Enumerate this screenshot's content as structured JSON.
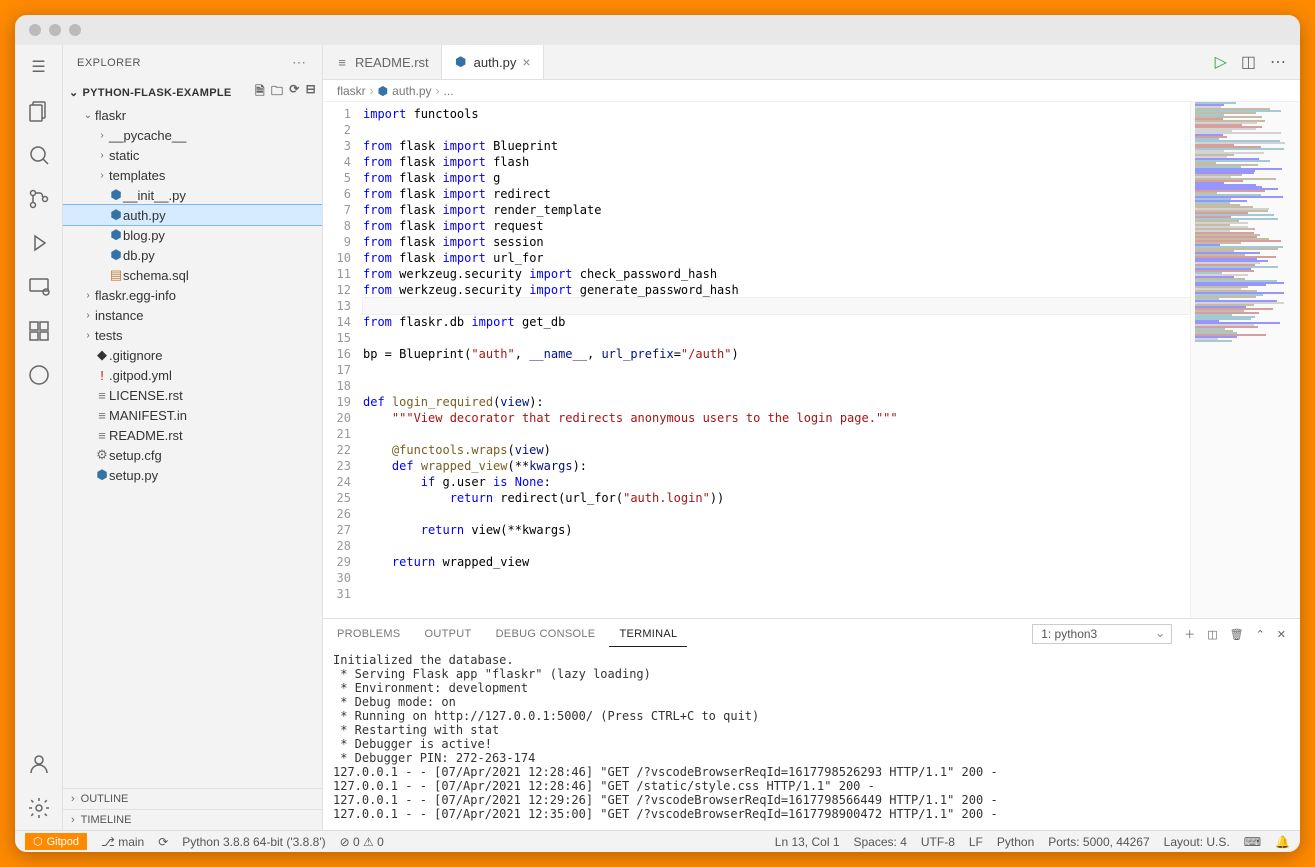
{
  "sidebar": {
    "title": "EXPLORER",
    "project": "PYTHON-FLASK-EXAMPLE",
    "outline": "OUTLINE",
    "timeline": "TIMELINE"
  },
  "tree": [
    {
      "depth": 1,
      "arrow": "⌄",
      "icon": "",
      "label": "flaskr",
      "kind": "folder"
    },
    {
      "depth": 2,
      "arrow": "›",
      "icon": "",
      "label": "__pycache__",
      "kind": "folder"
    },
    {
      "depth": 2,
      "arrow": "›",
      "icon": "",
      "label": "static",
      "kind": "folder"
    },
    {
      "depth": 2,
      "arrow": "›",
      "icon": "",
      "label": "templates",
      "kind": "folder"
    },
    {
      "depth": 2,
      "arrow": "",
      "icon": "py",
      "label": "__init__.py",
      "kind": "file"
    },
    {
      "depth": 2,
      "arrow": "",
      "icon": "py",
      "label": "auth.py",
      "kind": "file",
      "selected": true
    },
    {
      "depth": 2,
      "arrow": "",
      "icon": "py",
      "label": "blog.py",
      "kind": "file"
    },
    {
      "depth": 2,
      "arrow": "",
      "icon": "py",
      "label": "db.py",
      "kind": "file"
    },
    {
      "depth": 2,
      "arrow": "",
      "icon": "sql",
      "label": "schema.sql",
      "kind": "file"
    },
    {
      "depth": 1,
      "arrow": "›",
      "icon": "",
      "label": "flaskr.egg-info",
      "kind": "folder"
    },
    {
      "depth": 1,
      "arrow": "›",
      "icon": "",
      "label": "instance",
      "kind": "folder"
    },
    {
      "depth": 1,
      "arrow": "›",
      "icon": "",
      "label": "tests",
      "kind": "folder"
    },
    {
      "depth": 1,
      "arrow": "",
      "icon": "git",
      "label": ".gitignore",
      "kind": "file"
    },
    {
      "depth": 1,
      "arrow": "",
      "icon": "yml",
      "label": ".gitpod.yml",
      "kind": "file"
    },
    {
      "depth": 1,
      "arrow": "",
      "icon": "rst",
      "label": "LICENSE.rst",
      "kind": "file"
    },
    {
      "depth": 1,
      "arrow": "",
      "icon": "txt",
      "label": "MANIFEST.in",
      "kind": "file"
    },
    {
      "depth": 1,
      "arrow": "",
      "icon": "rst",
      "label": "README.rst",
      "kind": "file"
    },
    {
      "depth": 1,
      "arrow": "",
      "icon": "cfg",
      "label": "setup.cfg",
      "kind": "file"
    },
    {
      "depth": 1,
      "arrow": "",
      "icon": "py",
      "label": "setup.py",
      "kind": "file"
    }
  ],
  "tabs": [
    {
      "icon": "rst",
      "label": "README.rst",
      "active": false
    },
    {
      "icon": "py",
      "label": "auth.py",
      "active": true
    }
  ],
  "breadcrumb": [
    "flaskr",
    "auth.py",
    "..."
  ],
  "code": [
    [
      [
        "kw",
        "import"
      ],
      [
        "op",
        " functools"
      ]
    ],
    [],
    [
      [
        "kw",
        "from"
      ],
      [
        "op",
        " flask "
      ],
      [
        "kw",
        "import"
      ],
      [
        "op",
        " Blueprint"
      ]
    ],
    [
      [
        "kw",
        "from"
      ],
      [
        "op",
        " flask "
      ],
      [
        "kw",
        "import"
      ],
      [
        "op",
        " flash"
      ]
    ],
    [
      [
        "kw",
        "from"
      ],
      [
        "op",
        " flask "
      ],
      [
        "kw",
        "import"
      ],
      [
        "op",
        " g"
      ]
    ],
    [
      [
        "kw",
        "from"
      ],
      [
        "op",
        " flask "
      ],
      [
        "kw",
        "import"
      ],
      [
        "op",
        " redirect"
      ]
    ],
    [
      [
        "kw",
        "from"
      ],
      [
        "op",
        " flask "
      ],
      [
        "kw",
        "import"
      ],
      [
        "op",
        " render_template"
      ]
    ],
    [
      [
        "kw",
        "from"
      ],
      [
        "op",
        " flask "
      ],
      [
        "kw",
        "import"
      ],
      [
        "op",
        " request"
      ]
    ],
    [
      [
        "kw",
        "from"
      ],
      [
        "op",
        " flask "
      ],
      [
        "kw",
        "import"
      ],
      [
        "op",
        " session"
      ]
    ],
    [
      [
        "kw",
        "from"
      ],
      [
        "op",
        " flask "
      ],
      [
        "kw",
        "import"
      ],
      [
        "op",
        " url_for"
      ]
    ],
    [
      [
        "kw",
        "from"
      ],
      [
        "op",
        " werkzeug.security "
      ],
      [
        "kw",
        "import"
      ],
      [
        "op",
        " check_password_hash"
      ]
    ],
    [
      [
        "kw",
        "from"
      ],
      [
        "op",
        " werkzeug.security "
      ],
      [
        "kw",
        "import"
      ],
      [
        "op",
        " generate_password_hash"
      ]
    ],
    [],
    [
      [
        "kw",
        "from"
      ],
      [
        "op",
        " flaskr.db "
      ],
      [
        "kw",
        "import"
      ],
      [
        "op",
        " get_db"
      ]
    ],
    [],
    [
      [
        "op",
        "bp = Blueprint("
      ],
      [
        "st",
        "\"auth\""
      ],
      [
        "op",
        ", "
      ],
      [
        "va",
        "__name__"
      ],
      [
        "op",
        ", "
      ],
      [
        "va",
        "url_prefix"
      ],
      [
        "op",
        "="
      ],
      [
        "st",
        "\"/auth\""
      ],
      [
        "op",
        ")"
      ]
    ],
    [],
    [],
    [
      [
        "kw",
        "def "
      ],
      [
        "fn",
        "login_required"
      ],
      [
        "op",
        "("
      ],
      [
        "va",
        "view"
      ],
      [
        "op",
        "):"
      ]
    ],
    [
      [
        "op",
        "    "
      ],
      [
        "st",
        "\"\"\"View decorator that redirects anonymous users to the login page.\"\"\""
      ]
    ],
    [],
    [
      [
        "op",
        "    "
      ],
      [
        "fn",
        "@functools.wraps"
      ],
      [
        "op",
        "("
      ],
      [
        "va",
        "view"
      ],
      [
        "op",
        ")"
      ]
    ],
    [
      [
        "op",
        "    "
      ],
      [
        "kw",
        "def "
      ],
      [
        "fn",
        "wrapped_view"
      ],
      [
        "op",
        "(**"
      ],
      [
        "va",
        "kwargs"
      ],
      [
        "op",
        "):"
      ]
    ],
    [
      [
        "op",
        "        "
      ],
      [
        "kw",
        "if"
      ],
      [
        "op",
        " g.user "
      ],
      [
        "kw",
        "is"
      ],
      [
        "op",
        " "
      ],
      [
        "kw",
        "None"
      ],
      [
        "op",
        ":"
      ]
    ],
    [
      [
        "op",
        "            "
      ],
      [
        "kw",
        "return"
      ],
      [
        "op",
        " redirect(url_for("
      ],
      [
        "st",
        "\"auth.login\""
      ],
      [
        "op",
        "))"
      ]
    ],
    [],
    [
      [
        "op",
        "        "
      ],
      [
        "kw",
        "return"
      ],
      [
        "op",
        " view(**kwargs)"
      ]
    ],
    [],
    [
      [
        "op",
        "    "
      ],
      [
        "kw",
        "return"
      ],
      [
        "op",
        " wrapped_view"
      ]
    ],
    [],
    []
  ],
  "cursor_line": 13,
  "panel": {
    "tabs": [
      "PROBLEMS",
      "OUTPUT",
      "DEBUG CONSOLE",
      "TERMINAL"
    ],
    "active": 3,
    "select": "1: python3",
    "terminal": "Initialized the database.\n * Serving Flask app \"flaskr\" (lazy loading)\n * Environment: development\n * Debug mode: on\n * Running on http://127.0.0.1:5000/ (Press CTRL+C to quit)\n * Restarting with stat\n * Debugger is active!\n * Debugger PIN: 272-263-174\n127.0.0.1 - - [07/Apr/2021 12:28:46] \"GET /?vscodeBrowserReqId=1617798526293 HTTP/1.1\" 200 -\n127.0.0.1 - - [07/Apr/2021 12:28:46] \"GET /static/style.css HTTP/1.1\" 200 -\n127.0.0.1 - - [07/Apr/2021 12:29:26] \"GET /?vscodeBrowserReqId=1617798566449 HTTP/1.1\" 200 -\n127.0.0.1 - - [07/Apr/2021 12:35:00] \"GET /?vscodeBrowserReqId=1617798900472 HTTP/1.1\" 200 -"
  },
  "statusbar": {
    "gitpod": "Gitpod",
    "branch": "main",
    "python": "Python 3.8.8 64-bit ('3.8.8')",
    "errors": "0",
    "warnings": "0",
    "position": "Ln 13, Col 1",
    "spaces": "Spaces: 4",
    "encoding": "UTF-8",
    "eol": "LF",
    "language": "Python",
    "ports": "Ports: 5000, 44267",
    "layout": "Layout: U.S."
  }
}
